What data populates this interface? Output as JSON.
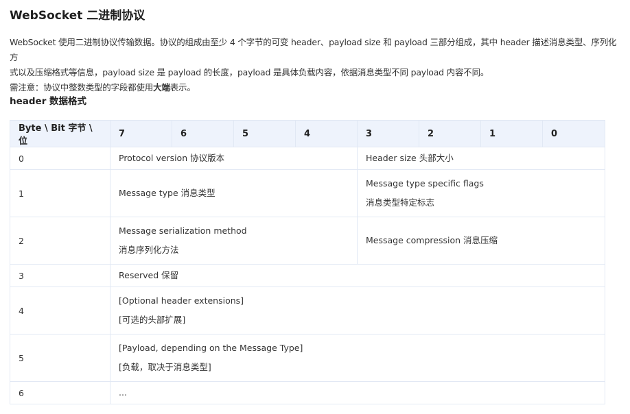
{
  "title": "WebSocket 二进制协议",
  "intro": {
    "line1": "WebSocket 使用二进制协议传输数据。协议的组成由至少 4 个字节的可变 header、payload size 和 payload 三部分组成，其中 header 描述消息类型、序列化方",
    "line2": "式以及压缩格式等信息，payload size 是 payload 的长度，payload 是具体负载内容，依据消息类型不同 payload 内容不同。",
    "note_prefix": "需注意：协议中整数类型的字段都使用",
    "note_emphasis": "大端",
    "note_suffix": "表示。"
  },
  "section_title": "header 数据格式",
  "table": {
    "headers": [
      "Byte \\ Bit  字节 \\ 位",
      "7",
      "6",
      "5",
      "4",
      "3",
      "2",
      "1",
      "0"
    ],
    "rows": [
      {
        "byte": "0",
        "high": [
          "Protocol version  协议版本"
        ],
        "low": [
          "Header size  头部大小"
        ]
      },
      {
        "byte": "1",
        "high": [
          "Message type  消息类型"
        ],
        "low": [
          "Message type specific flags",
          "消息类型特定标志"
        ]
      },
      {
        "byte": "2",
        "high": [
          "Message serialization method",
          "消息序列化方法"
        ],
        "low": [
          "Message compression  消息压缩"
        ]
      },
      {
        "byte": "3",
        "full": [
          "Reserved  保留"
        ]
      },
      {
        "byte": "4",
        "full": [
          "[Optional header extensions]",
          "[可选的头部扩展]"
        ]
      },
      {
        "byte": "5",
        "full": [
          "[Payload, depending on the Message Type]",
          "[负载，取决于消息类型]"
        ]
      },
      {
        "byte": "6",
        "full": [
          "..."
        ]
      }
    ]
  }
}
